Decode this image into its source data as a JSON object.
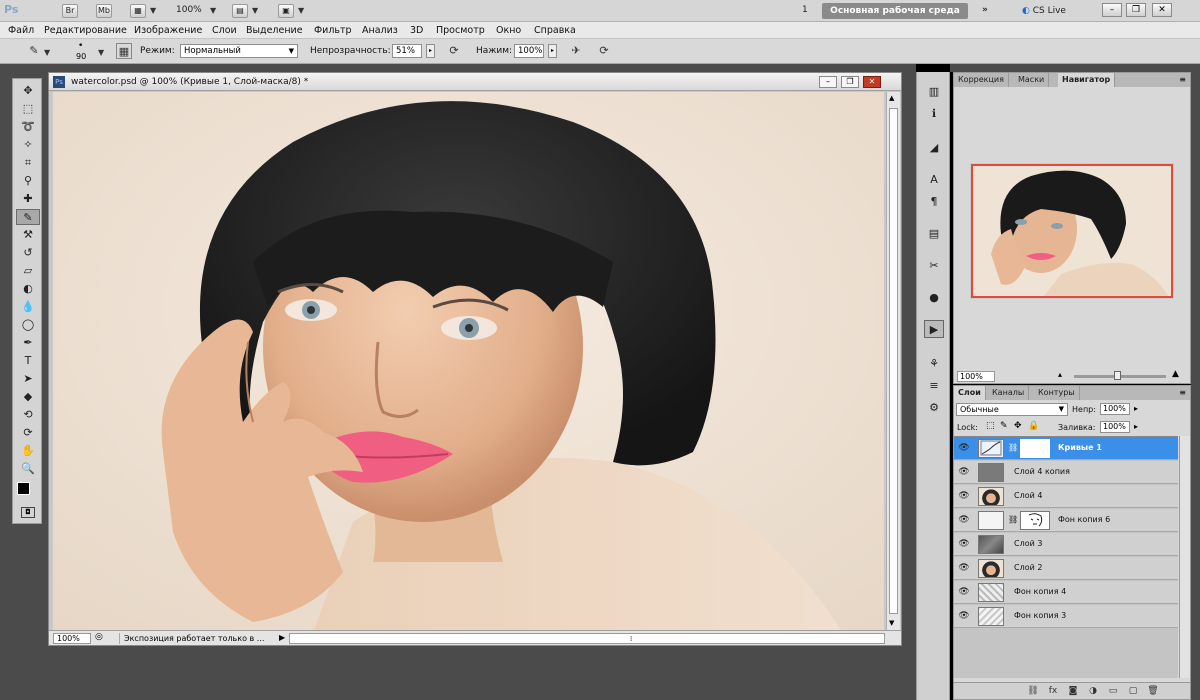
{
  "appbar": {
    "logo": "Ps",
    "br_label": "Br",
    "mb_label": "Mb",
    "zoom": "100%",
    "page_number": "1",
    "workspace": "Основная рабочая среда",
    "cs_live": "CS Live"
  },
  "menu": {
    "items": [
      "Файл",
      "Редактирование",
      "Изображение",
      "Слои",
      "Выделение",
      "Фильтр",
      "Анализ",
      "3D",
      "Просмотр",
      "Окно",
      "Справка"
    ]
  },
  "options": {
    "brush_size": "90",
    "mode_label": "Режим:",
    "mode_value": "Нормальный",
    "opacity_label": "Непрозрачность:",
    "opacity_value": "51%",
    "pressure_label": "Нажим:",
    "pressure_value": "100%"
  },
  "document": {
    "title": "watercolor.psd @ 100% (Кривые 1, Слой-маска/8) *",
    "zoom": "100%",
    "status": "Экспозиция работает только в ..."
  },
  "navigator": {
    "tabs": [
      "Коррекция",
      "Маски",
      "Навигатор"
    ],
    "active_tab": "Навигатор",
    "zoom": "100%"
  },
  "layers": {
    "tabs": [
      "Слои",
      "Каналы",
      "Контуры"
    ],
    "blend_mode": "Обычные",
    "opacity_label": "Непр:",
    "opacity_value": "100%",
    "lock_label": "Lock:",
    "fill_label": "Заливка:",
    "fill_value": "100%",
    "items": [
      {
        "name": "Кривые 1",
        "selected": true
      },
      {
        "name": "Слой 4 копия",
        "selected": false
      },
      {
        "name": "Слой 4",
        "selected": false
      },
      {
        "name": "Фон копия 6",
        "selected": false
      },
      {
        "name": "Слой 3",
        "selected": false
      },
      {
        "name": "Слой 2",
        "selected": false
      },
      {
        "name": "Фон копия 4",
        "selected": false
      },
      {
        "name": "Фон копия 3",
        "selected": false
      }
    ]
  },
  "colors": {
    "selection_blue": "#3b8fe8",
    "navigator_box": "#e24b3b",
    "canvas_bg": "#efe3d6"
  },
  "icons": {
    "tools": [
      "move-tool-icon",
      "marquee-tool-icon",
      "lasso-tool-icon",
      "quick-select-icon",
      "crop-tool-icon",
      "eyedropper-icon",
      "healing-brush-icon",
      "brush-tool-icon",
      "clone-stamp-icon",
      "history-brush-icon",
      "eraser-icon",
      "gradient-icon",
      "blur-icon",
      "dodge-icon",
      "pen-tool-icon",
      "type-tool-icon",
      "path-select-icon",
      "shape-tool-icon",
      "3d-rotate-icon",
      "3d-camera-icon",
      "hand-tool-icon",
      "zoom-tool-icon"
    ]
  }
}
